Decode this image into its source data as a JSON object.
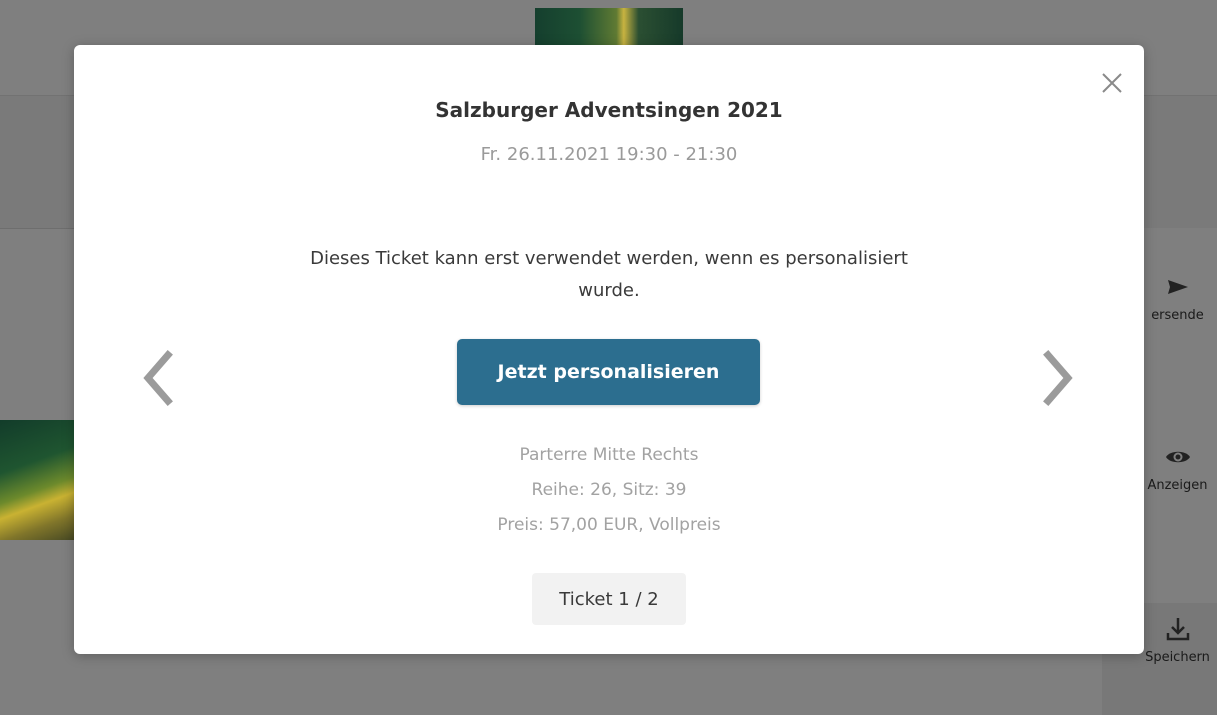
{
  "background": {
    "side_actions": [
      {
        "label": "ersende",
        "icon": "send-icon"
      },
      {
        "label": "Anzeigen",
        "icon": "eye-icon"
      },
      {
        "label": "Speichern",
        "icon": "download-icon"
      }
    ]
  },
  "modal": {
    "title": "Salzburger Adventsingen 2021",
    "datetime": "Fr. 26.11.2021 19:30 - 21:30",
    "message": "Dieses Ticket kann erst verwendet werden, wenn es personalisiert wurde.",
    "personalize_button": "Jetzt personalisieren",
    "seat": {
      "area": "Parterre Mitte Rechts",
      "row_seat": "Reihe: 26, Sitz: 39",
      "price": "Preis: 57,00 EUR, Vollpreis"
    },
    "ticket_counter": "Ticket 1 / 2",
    "icons": {
      "close": "close-icon",
      "prev": "chevron-left-icon",
      "next": "chevron-right-icon"
    }
  },
  "colors": {
    "accent": "#2c6e8f",
    "overlay": "#7f7f7f",
    "muted_text": "#a2a2a2"
  }
}
